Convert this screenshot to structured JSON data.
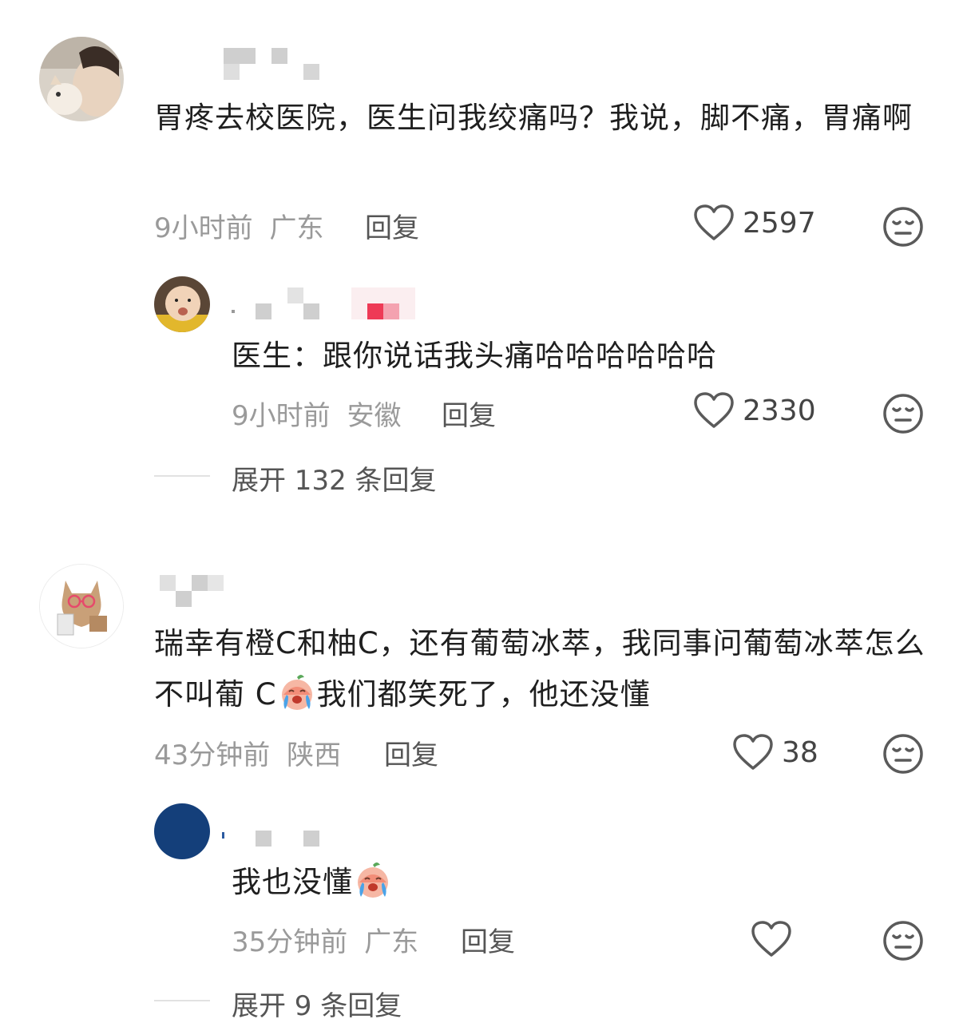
{
  "comments": [
    {
      "text": "胃疼去校医院，医生问我绞痛吗？我说，脚不痛，胃痛啊",
      "time": "9小时前",
      "location": "广东",
      "reply_label": "回复",
      "likes": "2597",
      "replies": [
        {
          "text": "医生：跟你说话我头痛哈哈哈哈哈哈",
          "time": "9小时前",
          "location": "安徽",
          "reply_label": "回复",
          "likes": "2330"
        }
      ],
      "expand_label": "展开 132 条回复"
    },
    {
      "text_part1": "瑞幸有橙C和柚C，还有葡萄冰萃，我同事问葡萄冰萃怎么不叫葡 C",
      "text_part2": "我们都笑死了，他还没懂",
      "time": "43分钟前",
      "location": "陕西",
      "reply_label": "回复",
      "likes": "38",
      "replies": [
        {
          "text": "我也没懂",
          "time": "35分钟前",
          "location": "广东",
          "reply_label": "回复",
          "likes": ""
        }
      ],
      "expand_label": "展开 9 条回复"
    }
  ],
  "icons": {
    "like": "heart-outline-icon",
    "dislike": "meh-face-icon",
    "emoji": "crying-laughing-peach-emoji"
  },
  "colors": {
    "text": "#1f1f1f",
    "meta": "#9a9a9a",
    "icon": "#5a5a5a",
    "divider": "#e2e2e2"
  }
}
